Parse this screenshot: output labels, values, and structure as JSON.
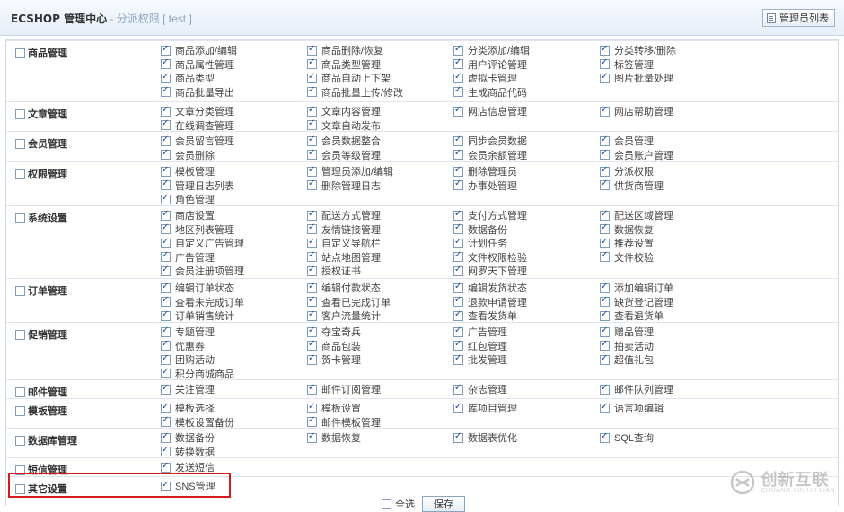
{
  "header": {
    "app_title": "ECSHOP 管理中心",
    "separator": " - ",
    "subtitle": "分派权限 [ test ]",
    "list_button": "管理员列表"
  },
  "groups": [
    {
      "name": "商品管理",
      "items": [
        "商品添加/编辑",
        "商品删除/恢复",
        "分类添加/编辑",
        "分类转移/删除",
        "商品属性管理",
        "商品类型管理",
        "用户评论管理",
        "标签管理",
        "商品类型",
        "商品自动上下架",
        "虚拟卡管理",
        "图片批量处理",
        "商品批量导出",
        "商品批量上传/修改",
        "生成商品代码"
      ]
    },
    {
      "name": "文章管理",
      "items": [
        "文章分类管理",
        "文章内容管理",
        "网店信息管理",
        "网店帮助管理",
        "在线调查管理",
        "文章自动发布"
      ]
    },
    {
      "name": "会员管理",
      "items": [
        "会员留言管理",
        "会员数据整合",
        "同步会员数据",
        "会员管理",
        "会员删除",
        "会员等级管理",
        "会员余额管理",
        "会员账户管理"
      ]
    },
    {
      "name": "权限管理",
      "items": [
        "模板管理",
        "管理员添加/编辑",
        "删除管理员",
        "分派权限",
        "管理日志列表",
        "删除管理日志",
        "办事处管理",
        "供货商管理",
        "角色管理"
      ]
    },
    {
      "name": "系统设置",
      "items": [
        "商店设置",
        "配送方式管理",
        "支付方式管理",
        "配送区域管理",
        "地区列表管理",
        "友情链接管理",
        "数据备份",
        "数据恢复",
        "自定义广告管理",
        "自定义导航栏",
        "计划任务",
        "推荐设置",
        "广告管理",
        "站点地图管理",
        "文件权限检验",
        "文件校验",
        "会员注册项管理",
        "授权证书",
        "网罗天下管理"
      ]
    },
    {
      "name": "订单管理",
      "items": [
        "编辑订单状态",
        "编辑付款状态",
        "编辑发货状态",
        "添加编辑订单",
        "查看未完成订单",
        "查看已完成订单",
        "退款申请管理",
        "缺货登记管理",
        "订单销售统计",
        "客户流量统计",
        "查看发货单",
        "查看退货单"
      ]
    },
    {
      "name": "促销管理",
      "items": [
        "专题管理",
        "夺宝奇兵",
        "广告管理",
        "赠品管理",
        "优惠券",
        "商品包装",
        "红包管理",
        "拍卖活动",
        "团购活动",
        "贺卡管理",
        "批发管理",
        "超值礼包",
        "积分商城商品"
      ]
    },
    {
      "name": "邮件管理",
      "items": [
        "关注管理",
        "邮件订阅管理",
        "杂志管理",
        "邮件队列管理"
      ]
    },
    {
      "name": "模板管理",
      "items": [
        "模板选择",
        "模板设置",
        "库项目管理",
        "语言项编辑",
        "模板设置备份",
        "邮件模板管理"
      ]
    },
    {
      "name": "数据库管理",
      "items": [
        "数据备份",
        "数据恢复",
        "数据表优化",
        "SQL查询",
        "转换数据"
      ]
    },
    {
      "name": "短信管理",
      "items": [
        "发送短信"
      ]
    },
    {
      "name": "其它设置",
      "items": [
        "SNS管理"
      ]
    }
  ],
  "footer": {
    "select_all": "全选",
    "save": "保存"
  },
  "watermark": {
    "brand": "创新互联",
    "sub": "CHUANG XIN HU LIAN"
  }
}
